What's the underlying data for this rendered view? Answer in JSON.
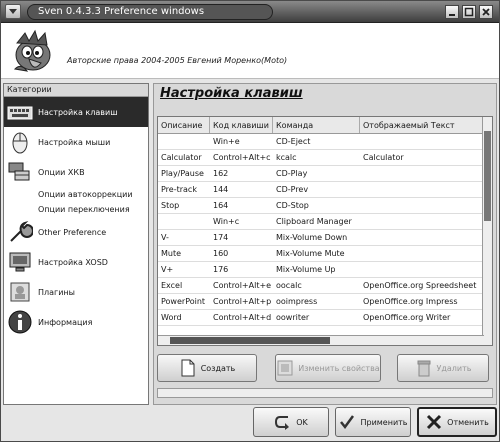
{
  "window": {
    "title": "Sven 0.4.3.3 Preference windows"
  },
  "header": {
    "copyright": "Авторские права 2004-2005 Евгений Моренко(Moto)"
  },
  "sidebar": {
    "heading": "Категории",
    "items": [
      {
        "label": "Настройка клавиш",
        "icon": "keyboard-icon",
        "active": true
      },
      {
        "label": "Настройка мыши",
        "icon": "mouse-icon"
      },
      {
        "label": "Опции ХКВ",
        "icon": "flags-icon"
      },
      {
        "label": "Опции автокоррекции"
      },
      {
        "label": "Опции переключения"
      },
      {
        "label": "Other Preference",
        "icon": "wrench-icon"
      },
      {
        "label": "Настройка XOSD",
        "icon": "monitor-icon"
      },
      {
        "label": "Плагины",
        "icon": "plugin-icon"
      },
      {
        "label": "Информация",
        "icon": "info-icon"
      }
    ]
  },
  "main": {
    "title": "Настройка клавиш",
    "columns": [
      "Описание",
      "Код клавиши",
      "Команда",
      "Отображаемый Текст"
    ],
    "rows": [
      [
        "",
        "Win+e",
        "CD-Eject",
        ""
      ],
      [
        "Calculator",
        "Control+Alt+c",
        "kcalc",
        "Calculator"
      ],
      [
        "Play/Pause",
        "162",
        "CD-Play",
        ""
      ],
      [
        "Pre-track",
        "144",
        "CD-Prev",
        ""
      ],
      [
        "Stop",
        "164",
        "CD-Stop",
        ""
      ],
      [
        "",
        "Win+c",
        "Clipboard Manager",
        ""
      ],
      [
        "V-",
        "174",
        "Mix-Volume Down",
        ""
      ],
      [
        "Mute",
        "160",
        "Mix-Volume Mute",
        ""
      ],
      [
        "V+",
        "176",
        "Mix-Volume Up",
        ""
      ],
      [
        "Excel",
        "Control+Alt+e",
        "oocalc",
        "OpenOffice.org Spreedsheet"
      ],
      [
        "PowerPoint",
        "Control+Alt+p",
        "ooimpress",
        "OpenOffice.org Impress"
      ],
      [
        "Word",
        "Control+Alt+d",
        "oowriter",
        "OpenOffice.org Writer"
      ]
    ],
    "buttons": {
      "create": "Создать",
      "edit": "Изменить свойства",
      "delete": "Удалить"
    }
  },
  "footer": {
    "ok": "OK",
    "apply": "Применить",
    "cancel": "Отменить"
  },
  "colors": {
    "active_bg": "#2a2a2a",
    "title_bar": "#3e3e3e"
  }
}
